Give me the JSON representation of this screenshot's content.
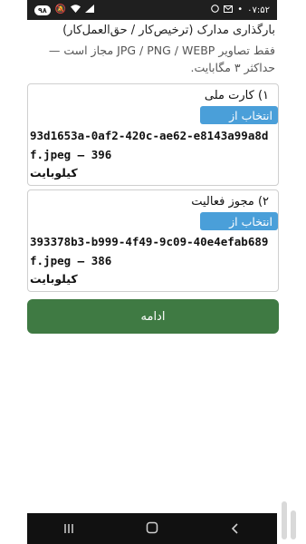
{
  "status_bar": {
    "time": "۰۷:۵۲",
    "battery": "۹۸",
    "left_icons": [
      "battery-icon",
      "mute-icon",
      "wifi-icon",
      "signal-icon"
    ],
    "right_icons": [
      "whatsapp-icon",
      "email-icon",
      "dot-icon"
    ]
  },
  "header": {
    "title": "بارگذاری مدارک (ترخیص‌کار / حق‌العمل‌کار)",
    "subtitle": "فقط تصاویر JPG / PNG / WEBP مجاز است — حداکثر ۳ مگابایت."
  },
  "documents": [
    {
      "label": "۱) کارت ملی",
      "button": "انتخاب از",
      "file_name": "93d1653a-0af2-420c-ae62-e8143a99a8df.jpeg — 396",
      "size_unit": "کیلوبایت"
    },
    {
      "label": "۲) مجوز فعالیت",
      "button": "انتخاب از",
      "file_name": "393378b3-b999-4f49-9c09-40e4efab689f.jpeg — 386",
      "size_unit": "کیلوبایت"
    }
  ],
  "continue_button": "ادامه",
  "nav_bar": {
    "icons": [
      "recent-apps-icon",
      "home-icon",
      "back-icon"
    ]
  },
  "colors": {
    "select_button": "#4a9fd9",
    "continue_button": "#3f7a43",
    "status_bar": "#1f1f1f",
    "nav_bar": "#111111"
  }
}
